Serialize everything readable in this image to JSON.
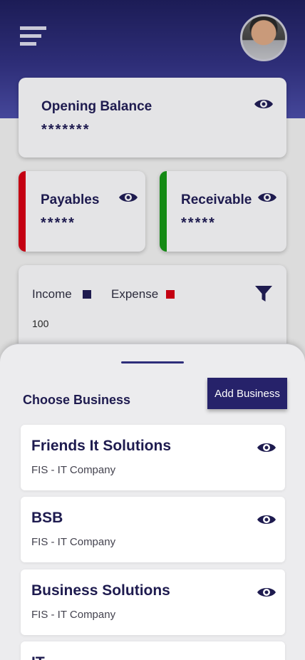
{
  "header": {
    "menu_icon": "hamburger-menu-icon",
    "avatar": "user-avatar"
  },
  "opening": {
    "title": "Opening Balance",
    "value": "*******",
    "icon": "eye-icon"
  },
  "payables": {
    "title": "Payables",
    "value": "*****",
    "accent": "#c40012",
    "icon": "eye-icon"
  },
  "receivable": {
    "title": "Receivable",
    "value": "*****",
    "accent": "#148a14",
    "icon": "eye-icon"
  },
  "chart": {
    "legend_income": "Income",
    "income_color": "#1e1b4f",
    "legend_expense": "Expense",
    "expense_color": "#c40012",
    "y_tick": "100",
    "filter_icon": "filter-icon"
  },
  "sheet": {
    "title": "Choose Business",
    "add_button": "Add Business",
    "businesses": [
      {
        "name": "Friends It Solutions",
        "subtitle": "FIS - IT Company"
      },
      {
        "name": "BSB",
        "subtitle": "FIS - IT Company"
      },
      {
        "name": "Business Solutions",
        "subtitle": "FIS - IT Company"
      },
      {
        "name": "IT",
        "subtitle": ""
      }
    ]
  },
  "colors": {
    "primary": "#1e1b4f",
    "button": "#26226a"
  }
}
